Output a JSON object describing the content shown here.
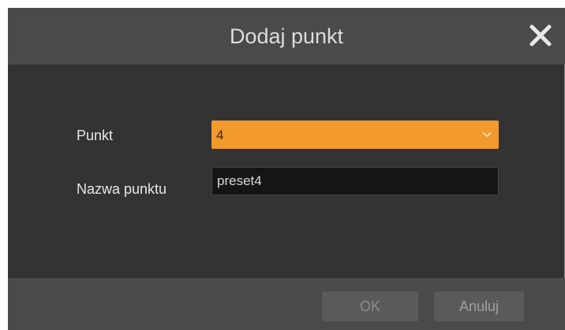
{
  "dialog": {
    "title": "Dodaj punkt",
    "close_icon": "close-icon"
  },
  "form": {
    "point_label": "Punkt",
    "point_value": "4",
    "point_name_label": "Nazwa punktu",
    "point_name_value": "preset4"
  },
  "footer": {
    "ok_label": "OK",
    "cancel_label": "Anuluj"
  },
  "colors": {
    "accent": "#f29a2e",
    "dialog_bg": "#333333",
    "bar_bg": "#4a4a4a"
  }
}
